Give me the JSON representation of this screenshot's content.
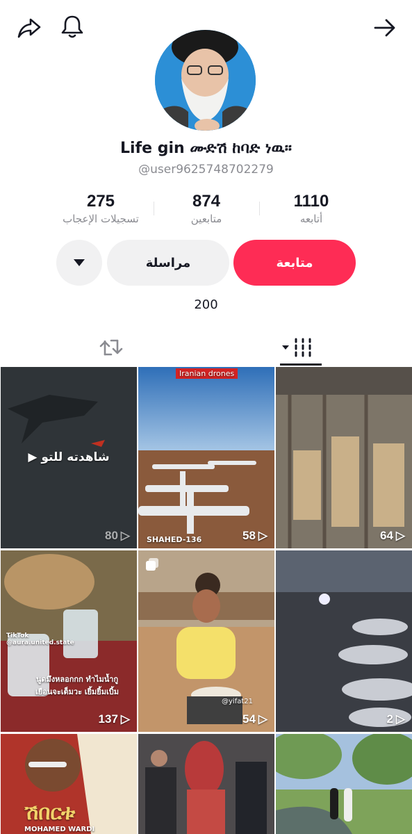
{
  "profile": {
    "display_name": "Life gin ሙድሽ ከባድ ነዉ።",
    "handle": "@user9625748702279",
    "bio": "200"
  },
  "stats": [
    {
      "value": "1110",
      "label": "أتابعه"
    },
    {
      "value": "874",
      "label": "متابعين"
    },
    {
      "value": "275",
      "label": "تسجيلات الإعجاب"
    }
  ],
  "actions": {
    "follow_label": "متابعة",
    "message_label": "مراسلة"
  },
  "icons": {
    "share": "share-icon",
    "bell": "bell-icon",
    "back": "arrow-right-icon",
    "more": "caret-down-icon",
    "reposts_tab": "repost-icon",
    "videos_tab": "grid-icon"
  },
  "videos": [
    {
      "views": "80",
      "overlay": "▶ شاهدته للتو",
      "tag": ""
    },
    {
      "views": "58",
      "overlay": "",
      "tag": "Iranian drones",
      "caption": "SHAHED-136"
    },
    {
      "views": "64",
      "overlay": "",
      "tag": ""
    },
    {
      "views": "137",
      "overlay": "นูดมึงหลอกกก ทำไมน้ำกูเยือนจะเต็มวะ เยิ้มยิ้มเบิ้ม",
      "tag": "TikTok @aura.united.state"
    },
    {
      "views": "54",
      "overlay": "",
      "tag": "@yifat21"
    },
    {
      "views": "2",
      "overlay": "",
      "tag": ""
    },
    {
      "views": "",
      "overlay": "ሽበርቱ",
      "tag": "MOHAMED WARDI"
    },
    {
      "views": "",
      "overlay": "",
      "tag": ""
    },
    {
      "views": "",
      "overlay": "",
      "tag": ""
    }
  ],
  "colors": {
    "accent": "#fe2c55",
    "secondary_button": "#f1f1f2",
    "muted_text": "#8a8b91"
  }
}
